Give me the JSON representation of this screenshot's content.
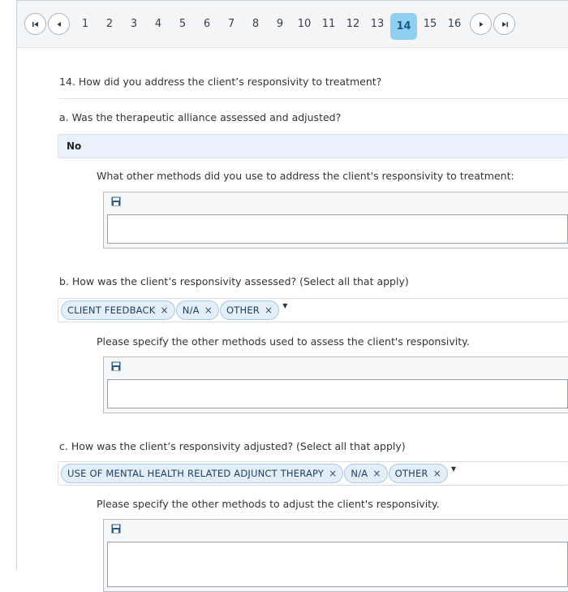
{
  "pager": {
    "pages": [
      "1",
      "2",
      "3",
      "4",
      "5",
      "6",
      "7",
      "8",
      "9",
      "10",
      "11",
      "12",
      "13",
      "14",
      "15",
      "16"
    ],
    "current": "14"
  },
  "question": {
    "title": "14. How did you address the client’s responsivity to treatment?"
  },
  "section_a": {
    "label": "a. Was the therapeutic alliance assessed and adjusted?",
    "answer": "No",
    "followup_label": "What other methods did you use to address the client's responsivity to treatment:",
    "followup_value": ""
  },
  "section_b": {
    "label": "b. How was the client’s responsivity assessed? (Select all that apply)",
    "chips": [
      "CLIENT FEEDBACK",
      "N/A",
      "OTHER"
    ],
    "followup_label": "Please specify the other methods used to assess the client's responsivity.",
    "followup_value": ""
  },
  "section_c": {
    "label": "c. How was the client’s responsivity adjusted? (Select all that apply)",
    "chips": [
      "USE OF MENTAL HEALTH RELATED ADJUNCT THERAPY",
      "N/A",
      "OTHER"
    ],
    "followup_label": "Please specify the other methods to adjust the client's responsivity.",
    "followup_value": ""
  },
  "icons": {
    "chip_remove": "×",
    "dropdown": "▼"
  },
  "colors": {
    "active_page": "#8fd0f2",
    "chip_bg": "#e3eef9",
    "answer_bg": "#e9f2fb"
  }
}
